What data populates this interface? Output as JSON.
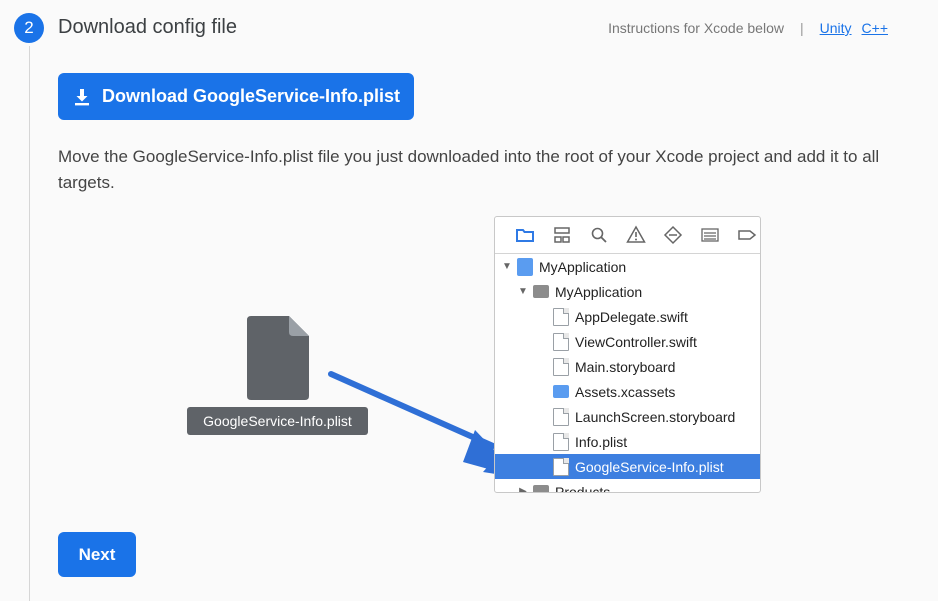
{
  "step": {
    "number": "2",
    "title": "Download config file"
  },
  "platform_links": {
    "note": "Instructions for Xcode below",
    "separator": "|",
    "unity": "Unity",
    "cpp": "C++"
  },
  "download_button": {
    "label": "Download GoogleService-Info.plist",
    "icon": "download-icon"
  },
  "instructions": "Move the GoogleService-Info.plist file you just downloaded into the root of your Xcode project and add it to all targets.",
  "dragged_file": {
    "label": "GoogleService-Info.plist"
  },
  "xcode_navigator": {
    "toolbar_icons": [
      "folder-icon",
      "hierarchy-icon",
      "search-icon",
      "warning-icon",
      "test-diamond-icon",
      "list-icon",
      "tag-icon"
    ],
    "tree": [
      {
        "label": "MyApplication",
        "kind": "project",
        "expanded": true
      },
      {
        "label": "MyApplication",
        "kind": "folder",
        "expanded": true
      },
      {
        "label": "AppDelegate.swift",
        "kind": "swift"
      },
      {
        "label": "ViewController.swift",
        "kind": "swift"
      },
      {
        "label": "Main.storyboard",
        "kind": "file"
      },
      {
        "label": "Assets.xcassets",
        "kind": "folder-blue"
      },
      {
        "label": "LaunchScreen.storyboard",
        "kind": "file"
      },
      {
        "label": "Info.plist",
        "kind": "file"
      },
      {
        "label": "GoogleService-Info.plist",
        "kind": "file",
        "selected": true
      },
      {
        "label": "Products",
        "kind": "folder",
        "expanded": false
      }
    ]
  },
  "next_button": {
    "label": "Next"
  },
  "colors": {
    "accent": "#1a73e8",
    "selection": "#3d7fe0",
    "file_label_bg": "#5f6368"
  }
}
